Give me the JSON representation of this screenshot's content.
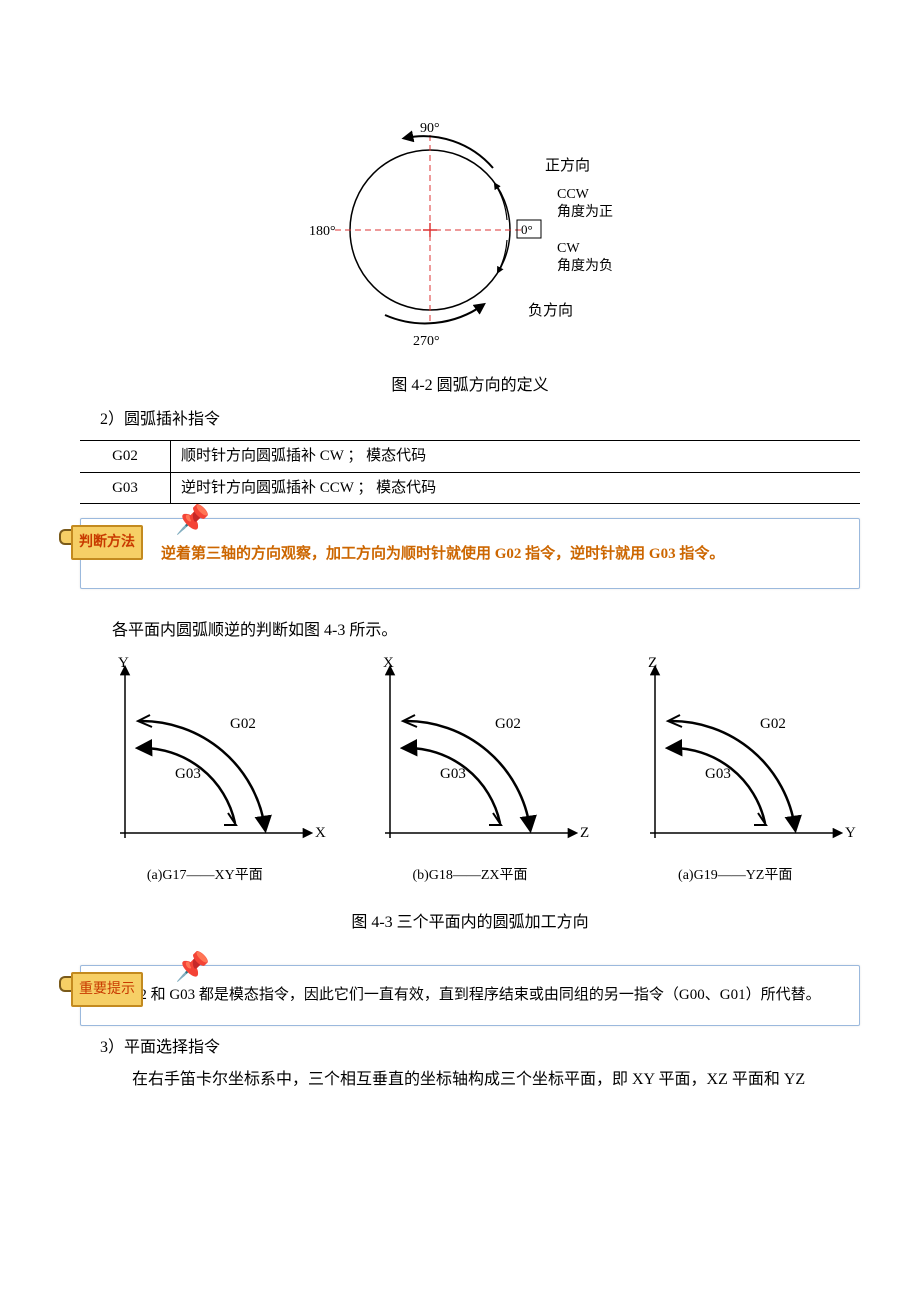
{
  "fig42": {
    "caption": "图 4-2   圆弧方向的定义",
    "labels": {
      "a90": "90°",
      "a180": "180°",
      "a270": "270°",
      "a0": "0°",
      "posDir": "正方向",
      "negDir": "负方向",
      "ccw": "CCW",
      "ccwNote": "角度为正",
      "cw": "CW",
      "cwNote": "角度为负"
    }
  },
  "section2": {
    "title": "2）圆弧插补指令"
  },
  "table": {
    "rows": [
      {
        "code": "G02",
        "desc": "顺时针方向圆弧插补 CW    ；   模态代码"
      },
      {
        "code": "G03",
        "desc": "逆时针方向圆弧插补 CCW  ；   模态代码"
      }
    ]
  },
  "callout1": {
    "tag": "判断方法",
    "text": "逆着第三轴的方向观察，加工方向为顺时针就使用 G02 指令，逆时针就用 G03 指令。"
  },
  "para1": "各平面内圆弧顺逆的判断如图 4-3 所示。",
  "fig43": {
    "caption": "图 4-3  三个平面内的圆弧加工方向",
    "items": [
      {
        "vAxis": "Y",
        "hAxis": "X",
        "g02": "G02",
        "g03": "G03",
        "sub": "(a)G17——XY平面"
      },
      {
        "vAxis": "X",
        "hAxis": "Z",
        "g02": "G02",
        "g03": "G03",
        "sub": "(b)G18——ZX平面"
      },
      {
        "vAxis": "Z",
        "hAxis": "Y",
        "g02": "G02",
        "g03": "G03",
        "sub": "(a)G19——YZ平面"
      }
    ]
  },
  "callout2": {
    "tag": "重要提示",
    "text": "G02 和 G03 都是模态指令，因此它们一直有效，直到程序结束或由同组的另一指令（G00、G01）所代替。"
  },
  "section3": {
    "title": "3）平面选择指令",
    "para": "在右手笛卡尔坐标系中，三个相互垂直的坐标轴构成三个坐标平面，即 XY 平面，XZ 平面和 YZ"
  }
}
